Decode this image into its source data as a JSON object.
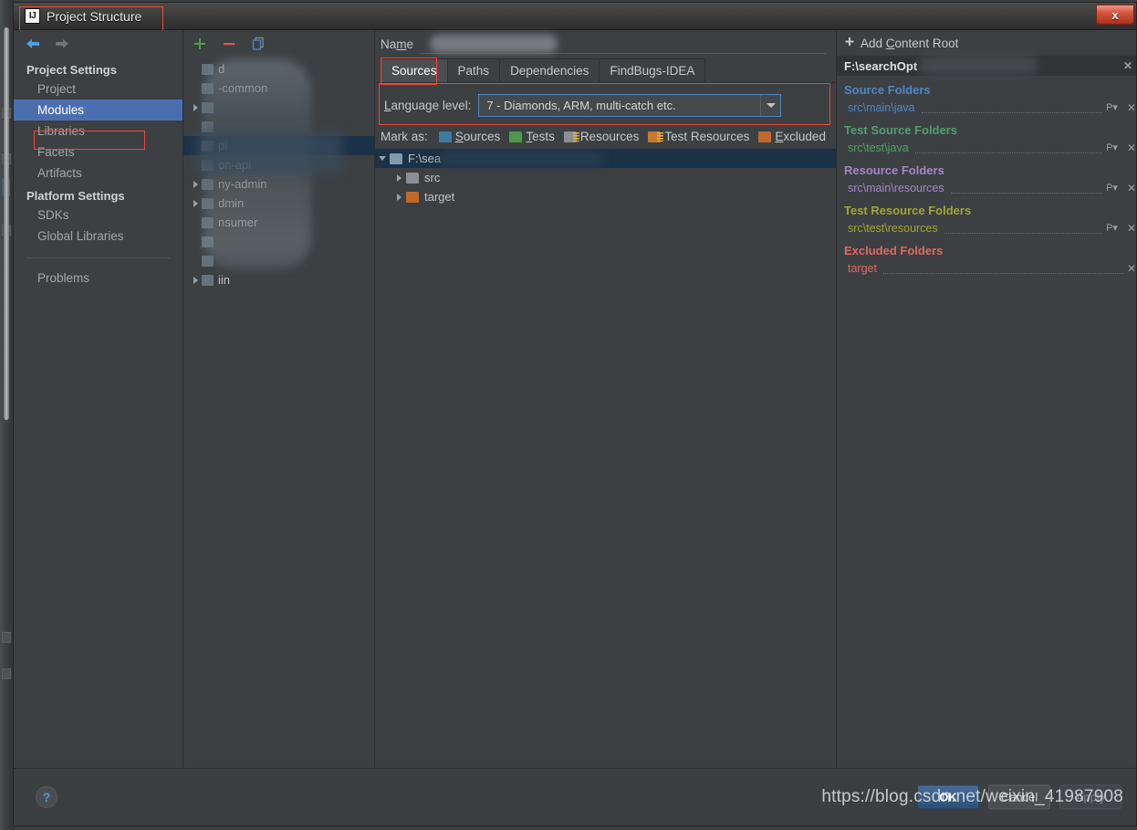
{
  "window": {
    "title": "Project Structure",
    "logo_text": "IJ",
    "close_label": "x"
  },
  "sidebar": {
    "back_icon": "back-arrow-icon",
    "forward_icon": "forward-arrow-icon",
    "sections": [
      {
        "title": "Project Settings",
        "items": [
          {
            "label": "Project",
            "selected": false
          },
          {
            "label": "Modules",
            "selected": true
          },
          {
            "label": "Libraries",
            "selected": false
          },
          {
            "label": "Facets",
            "selected": false
          },
          {
            "label": "Artifacts",
            "selected": false
          }
        ]
      },
      {
        "title": "Platform Settings",
        "items": [
          {
            "label": "SDKs",
            "selected": false
          },
          {
            "label": "Global Libraries",
            "selected": false
          }
        ]
      }
    ],
    "problems_label": "Problems"
  },
  "modules": {
    "toolbar": {
      "add_label": "+",
      "remove_label": "–",
      "copy_label": "copy-icon"
    },
    "items": [
      {
        "label": "d",
        "expandable": false,
        "selected": false
      },
      {
        "label": "-common",
        "expandable": false,
        "selected": false
      },
      {
        "label": "",
        "expandable": true,
        "selected": false
      },
      {
        "label": "",
        "expandable": false,
        "selected": false
      },
      {
        "label": "pi",
        "expandable": false,
        "selected": true
      },
      {
        "label": "on-api",
        "expandable": false,
        "selected": false
      },
      {
        "label": "ny-admin",
        "expandable": true,
        "selected": false
      },
      {
        "label": "dmin",
        "expandable": true,
        "selected": false
      },
      {
        "label": "nsumer",
        "expandable": false,
        "selected": false
      },
      {
        "label": "",
        "expandable": false,
        "selected": false
      },
      {
        "label": "",
        "expandable": false,
        "selected": false
      },
      {
        "label": "iin",
        "expandable": true,
        "selected": false
      }
    ]
  },
  "main": {
    "name_label": "Name",
    "name_value": "",
    "name_placeholder": "",
    "tabs": [
      {
        "label": "Sources",
        "active": true
      },
      {
        "label": "Paths",
        "active": false
      },
      {
        "label": "Dependencies",
        "active": false
      },
      {
        "label": "FindBugs-IDEA",
        "active": false
      }
    ],
    "language_level": {
      "label": "Language level:",
      "value": "7 - Diamonds, ARM, multi-catch etc.",
      "arrow_icon": "chevron-down-icon"
    },
    "mark_as": {
      "label": "Mark as:",
      "options": [
        {
          "label": "Sources",
          "color": "#3b7ca0",
          "icon": "folder-sources-icon"
        },
        {
          "label": "Tests",
          "color": "#4e9a4e",
          "icon": "folder-tests-icon"
        },
        {
          "label": "Resources",
          "color": "#8a9095",
          "icon": "folder-resources-icon"
        },
        {
          "label": "Test Resources",
          "color": "#c7792e",
          "icon": "folder-test-resources-icon"
        },
        {
          "label": "Excluded",
          "color": "#c06a2a",
          "icon": "folder-excluded-icon"
        }
      ]
    },
    "content_tree": [
      {
        "label": "F:\\sea",
        "expanded": true,
        "depth": 0,
        "selected": true,
        "color": "#7f9bb0"
      },
      {
        "label": "src",
        "expanded": false,
        "depth": 1,
        "selected": false,
        "color": "#8a9095"
      },
      {
        "label": "target",
        "expanded": false,
        "depth": 1,
        "selected": false,
        "color": "#c06a2a"
      }
    ]
  },
  "roots": {
    "add_content_root_label": "Add Content Root",
    "add_icon": "plus-icon",
    "root_path": "F:\\searchOpt",
    "remove_root_icon": "x-icon",
    "package_prefix_icon": "package-prefix-icon",
    "groups": [
      {
        "title": "Source Folders",
        "color": "#4e86c7",
        "rows": [
          {
            "path": "src\\main\\java",
            "has_prefix": true,
            "has_remove": true
          }
        ]
      },
      {
        "title": "Test Source Folders",
        "color": "#51a06b",
        "rows": [
          {
            "path": "src\\test\\java",
            "has_prefix": true,
            "has_remove": true
          }
        ]
      },
      {
        "title": "Resource Folders",
        "color": "#a585c4",
        "rows": [
          {
            "path": "src\\main\\resources",
            "has_prefix": true,
            "has_remove": true
          }
        ]
      },
      {
        "title": "Test Resource Folders",
        "color": "#a3a52e",
        "rows": [
          {
            "path": "src\\test\\resources",
            "has_prefix": true,
            "has_remove": true
          }
        ]
      },
      {
        "title": "Excluded Folders",
        "color": "#e0695f",
        "rows": [
          {
            "path": "target",
            "has_prefix": false,
            "has_remove": true
          }
        ]
      }
    ]
  },
  "footer": {
    "help_label": "?",
    "ok_label": "OK",
    "cancel_label": "Cancel",
    "apply_label": "Apply",
    "watermark": "https://blog.csdn.net/weixin_41987908"
  }
}
